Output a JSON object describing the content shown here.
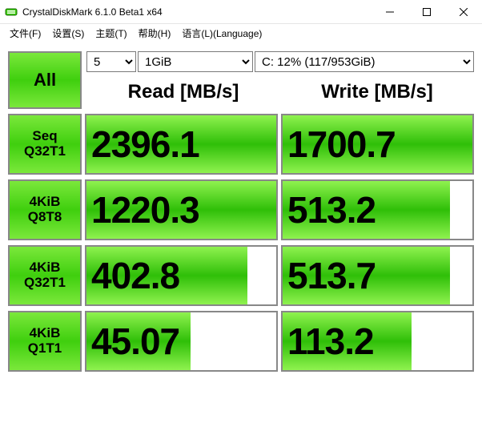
{
  "window": {
    "title": "CrystalDiskMark 6.1.0 Beta1 x64"
  },
  "menu": {
    "file": "文件(F)",
    "settings": "设置(S)",
    "theme": "主题(T)",
    "help": "帮助(H)",
    "language": "语言(L)(Language)"
  },
  "controls": {
    "all_label": "All",
    "count": "5",
    "size": "1GiB",
    "drive": "C: 12% (117/953GiB)"
  },
  "headers": {
    "read": "Read [MB/s]",
    "write": "Write [MB/s]"
  },
  "rows": [
    {
      "l1": "Seq",
      "l2": "Q32T1",
      "read": "2396.1",
      "read_pct": 100,
      "write": "1700.7",
      "write_pct": 100
    },
    {
      "l1": "4KiB",
      "l2": "Q8T8",
      "read": "1220.3",
      "read_pct": 100,
      "write": "513.2",
      "write_pct": 88
    },
    {
      "l1": "4KiB",
      "l2": "Q32T1",
      "read": "402.8",
      "read_pct": 85,
      "write": "513.7",
      "write_pct": 88
    },
    {
      "l1": "4KiB",
      "l2": "Q1T1",
      "read": "45.07",
      "read_pct": 55,
      "write": "113.2",
      "write_pct": 68
    }
  ],
  "chart_data": {
    "type": "table",
    "title": "CrystalDiskMark 6.1.0 Beta1 x64",
    "drive": "C: 12% (117/953GiB)",
    "runs": 5,
    "test_size": "1GiB",
    "columns": [
      "Test",
      "Read [MB/s]",
      "Write [MB/s]"
    ],
    "rows": [
      [
        "Seq Q32T1",
        2396.1,
        1700.7
      ],
      [
        "4KiB Q8T8",
        1220.3,
        513.2
      ],
      [
        "4KiB Q32T1",
        402.8,
        513.7
      ],
      [
        "4KiB Q1T1",
        45.07,
        113.2
      ]
    ]
  }
}
